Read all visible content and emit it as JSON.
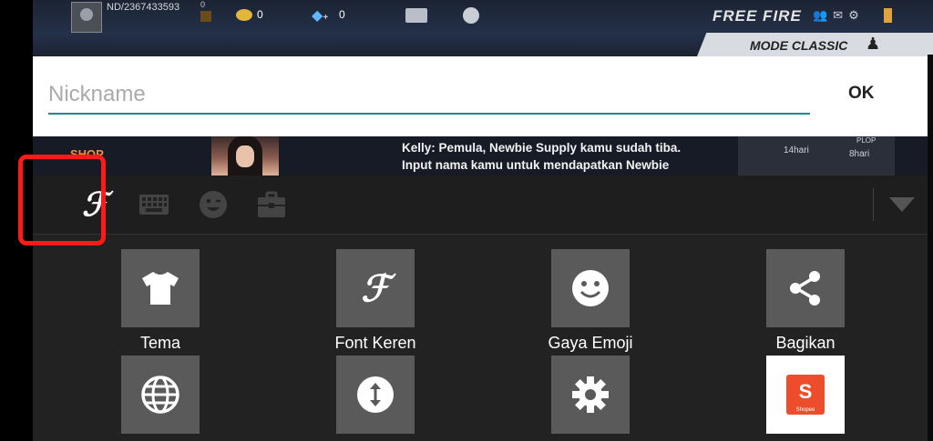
{
  "game": {
    "player_id": "ND/2367433593",
    "rank_value": "0",
    "coins": "0",
    "diamond_plus": "+",
    "diamonds": "0",
    "logo": "FREE FIRE",
    "mode": "MODE CLASSIC",
    "shop_label": "SHOP",
    "tutorial_line1": "Kelly: Pemula, Newbie Supply kamu sudah tiba.",
    "tutorial_line2": "Input nama kamu untuk mendapatkan Newbie",
    "reward_a": "14hari",
    "reward_b": "8hari",
    "reward_c": "PLOP"
  },
  "dialog": {
    "placeholder": "Nickname",
    "value": "",
    "ok_label": "OK",
    "accent_color": "#1e8a83"
  },
  "keyboard": {
    "toolbar": [
      {
        "name": "font-icon",
        "selected": true
      },
      {
        "name": "keyboard-icon"
      },
      {
        "name": "emoji-icon"
      },
      {
        "name": "toolbox-icon"
      },
      {
        "name": "collapse-triangle-icon"
      }
    ],
    "highlight_color": "#ff1a1a",
    "grid": [
      {
        "icon": "tshirt-icon",
        "label": "Tema"
      },
      {
        "icon": "font-icon",
        "label": "Font Keren"
      },
      {
        "icon": "smiley-icon",
        "label": "Gaya Emoji"
      },
      {
        "icon": "share-icon",
        "label": "Bagikan"
      },
      {
        "icon": "globe-icon",
        "label": ""
      },
      {
        "icon": "resize-arrows-icon",
        "label": ""
      },
      {
        "icon": "gear-icon",
        "label": ""
      },
      {
        "icon": "shopee-logo",
        "label": ""
      }
    ],
    "shopee_text": "Shopee",
    "shopee_letter": "S"
  }
}
